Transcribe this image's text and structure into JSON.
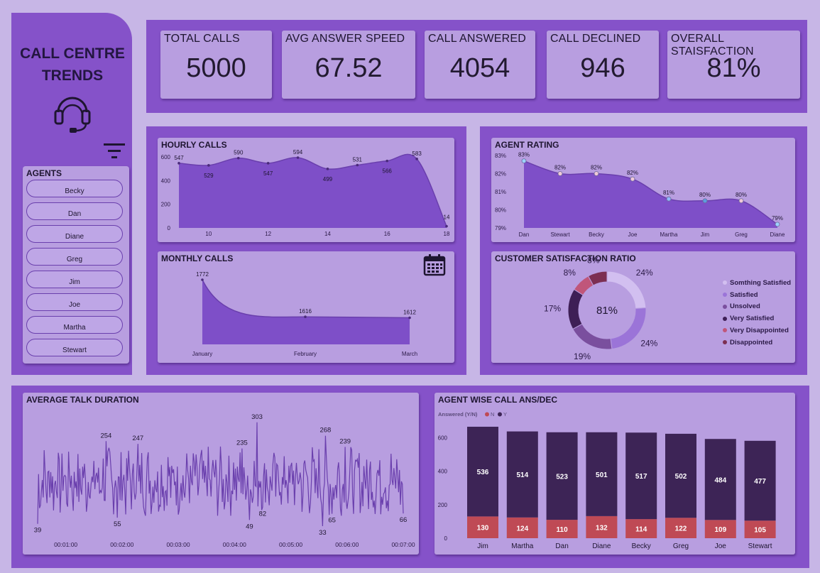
{
  "title": "CALL CENTRE\nTRENDS",
  "icons": {
    "headset": "headset-icon",
    "filter": "filter-icon",
    "calendar": "calendar-icon"
  },
  "colors": {
    "background": "#c7b6e6",
    "band": "#8552c9",
    "card": "#b89ee0",
    "area": "#7e4fc8",
    "line": "#6a3fad",
    "answered": "#3d2456",
    "declined": "#bf4a55"
  },
  "kpis": [
    {
      "label": "TOTAL CALLS",
      "value": "5000"
    },
    {
      "label": "AVG ANSWER SPEED",
      "value": "67.52"
    },
    {
      "label": "CALL ANSWERED",
      "value": "4054"
    },
    {
      "label": "CALL DECLINED",
      "value": "946"
    },
    {
      "label": "OVERALL STAISFACTION",
      "value": "81%"
    }
  ],
  "agents": {
    "title": "AGENTS",
    "items": [
      "Becky",
      "Dan",
      "Diane",
      "Greg",
      "Jim",
      "Joe",
      "Martha",
      "Stewart"
    ]
  },
  "chart_data": [
    {
      "id": "hourly",
      "type": "area",
      "title": "HOURLY CALLS",
      "x": [
        9,
        10,
        11,
        12,
        13,
        14,
        15,
        16,
        17,
        18
      ],
      "values": [
        547,
        529,
        590,
        547,
        594,
        499,
        531,
        566,
        583,
        14
      ],
      "xticks": [
        10,
        12,
        14,
        16,
        18
      ],
      "yticks": [
        0,
        200,
        400,
        600
      ],
      "ylim": [
        0,
        600
      ],
      "xlim": [
        9,
        18
      ]
    },
    {
      "id": "monthly",
      "type": "area",
      "title": "MONTHLY CALLS",
      "categories": [
        "January",
        "February",
        "March"
      ],
      "values": [
        1772,
        1616,
        1612
      ]
    },
    {
      "id": "rating",
      "type": "area",
      "title": "AGENT RATING",
      "categories": [
        "Dan",
        "Stewart",
        "Becky",
        "Joe",
        "Martha",
        "Jim",
        "Greg",
        "Diane"
      ],
      "values": [
        82.7,
        82.0,
        82.0,
        81.7,
        80.6,
        80.5,
        80.5,
        79.2
      ],
      "labels": [
        "83%",
        "82%",
        "82%",
        "82%",
        "81%",
        "80%",
        "80%",
        "79%"
      ],
      "yticks": [
        "79%",
        "80%",
        "81%",
        "82%",
        "83%"
      ],
      "ylim": [
        79,
        83
      ]
    },
    {
      "id": "satisfaction",
      "type": "pie",
      "title": "CUSTOMER SATISFACTION RATIO",
      "center_label": "81%",
      "slices": [
        {
          "name": "Somthing Satisfied",
          "value": 24,
          "label": "24%",
          "color": "#d2bff0"
        },
        {
          "name": "Satisfied",
          "value": 24,
          "label": "24%",
          "color": "#9b74d8"
        },
        {
          "name": "Unsolved",
          "value": 19,
          "label": "19%",
          "color": "#7a4f9e"
        },
        {
          "name": "Very Satisfied",
          "value": 17,
          "label": "17%",
          "color": "#3e1f56"
        },
        {
          "name": "Very Disappointed",
          "value": 8,
          "label": "8%",
          "color": "#c0567a"
        },
        {
          "name": "Disappointed",
          "value": 8,
          "label": "8%",
          "color": "#7c2f52"
        }
      ]
    },
    {
      "id": "talk",
      "type": "line",
      "title": "AVERAGE TALK DURATION",
      "xticks": [
        "00:01:00",
        "00:02:00",
        "00:03:00",
        "00:04:00",
        "00:05:00",
        "00:06:00",
        "00:07:00"
      ],
      "x_range_seconds": [
        30,
        420
      ],
      "ylim": [
        20,
        310
      ],
      "annotations": [
        {
          "x": 30,
          "y": 39,
          "label": "39"
        },
        {
          "x": 103,
          "y": 254,
          "label": "254"
        },
        {
          "x": 115,
          "y": 55,
          "label": "55"
        },
        {
          "x": 137,
          "y": 247,
          "label": "247"
        },
        {
          "x": 248,
          "y": 235,
          "label": "235"
        },
        {
          "x": 256,
          "y": 49,
          "label": "49"
        },
        {
          "x": 264,
          "y": 303,
          "label": "303"
        },
        {
          "x": 270,
          "y": 82,
          "label": "82"
        },
        {
          "x": 334,
          "y": 33,
          "label": "33"
        },
        {
          "x": 337,
          "y": 268,
          "label": "268"
        },
        {
          "x": 344,
          "y": 65,
          "label": "65"
        },
        {
          "x": 358,
          "y": 239,
          "label": "239"
        },
        {
          "x": 420,
          "y": 66,
          "label": "66"
        }
      ]
    },
    {
      "id": "agentwise",
      "type": "bar",
      "title": "AGENT WISE CALL ANS/DEC",
      "legend_title": "Answered (Y/N)",
      "categories": [
        "Jim",
        "Martha",
        "Dan",
        "Diane",
        "Becky",
        "Greg",
        "Joe",
        "Stewart"
      ],
      "series": [
        {
          "name": "N",
          "values": [
            130,
            124,
            110,
            132,
            114,
            122,
            109,
            105
          ],
          "color": "#bf4a55"
        },
        {
          "name": "Y",
          "values": [
            536,
            514,
            523,
            501,
            517,
            502,
            484,
            477
          ],
          "color": "#3d2456"
        }
      ],
      "yticks": [
        0,
        200,
        400,
        600
      ],
      "ylim": [
        0,
        700
      ]
    }
  ]
}
